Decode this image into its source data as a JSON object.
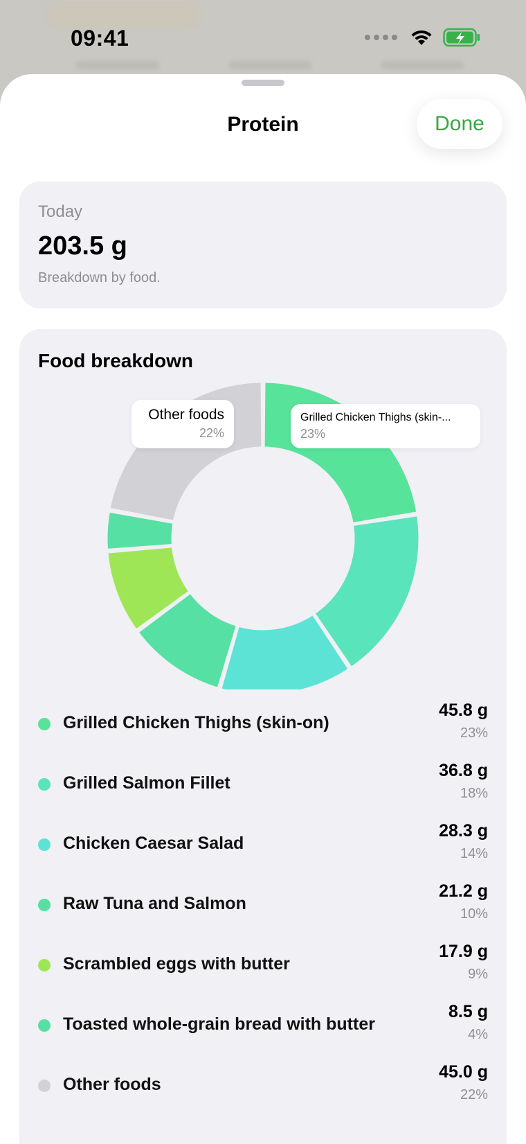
{
  "status_bar": {
    "time": "09:41"
  },
  "sheet": {
    "title": "Protein",
    "done_label": "Done"
  },
  "today": {
    "label": "Today",
    "value": "203.5 g",
    "caption": "Breakdown by food."
  },
  "breakdown": {
    "title": "Food breakdown",
    "callouts": {
      "left": {
        "name": "Other foods",
        "pct": "22%"
      },
      "right": {
        "name": "Grilled Chicken Thighs (skin-...",
        "pct": "23%"
      }
    }
  },
  "chart_data": {
    "type": "pie",
    "title": "Food breakdown",
    "unit": "g",
    "categories": [
      "Grilled Chicken Thighs (skin-on)",
      "Grilled Salmon Fillet",
      "Chicken Caesar Salad",
      "Raw Tuna and Salmon",
      "Scrambled eggs with butter",
      "Toasted whole-grain bread with butter",
      "Other foods"
    ],
    "values": [
      45.8,
      36.8,
      28.3,
      21.2,
      17.9,
      8.5,
      45.0
    ],
    "percentages": [
      23,
      18,
      14,
      10,
      9,
      4,
      22
    ],
    "colors": [
      "#57e39a",
      "#5ae4bb",
      "#5ce3d6",
      "#57e0a4",
      "#9fe656",
      "#57e0a4",
      "#d1d1d6"
    ]
  },
  "legend": [
    {
      "name": "Grilled Chicken Thighs (skin-on)",
      "grams": "45.8 g",
      "pct": "23%",
      "color": "#57e39a"
    },
    {
      "name": "Grilled Salmon Fillet",
      "grams": "36.8 g",
      "pct": "18%",
      "color": "#5ae4bb"
    },
    {
      "name": "Chicken Caesar Salad",
      "grams": "28.3 g",
      "pct": "14%",
      "color": "#5ce3d6"
    },
    {
      "name": "Raw Tuna and Salmon",
      "grams": "21.2 g",
      "pct": "10%",
      "color": "#57e0a4"
    },
    {
      "name": "Scrambled eggs with butter",
      "grams": "17.9 g",
      "pct": "9%",
      "color": "#9fe656"
    },
    {
      "name": "Toasted whole-grain bread with butter",
      "grams": "8.5 g",
      "pct": "4%",
      "color": "#57e0a4"
    },
    {
      "name": "Other foods",
      "grams": "45.0 g",
      "pct": "22%",
      "color": "#d1d1d6"
    }
  ],
  "colors": {
    "accent": "#38a844",
    "card_bg": "#f0f0f5",
    "secondary_text": "#8e8e93"
  }
}
